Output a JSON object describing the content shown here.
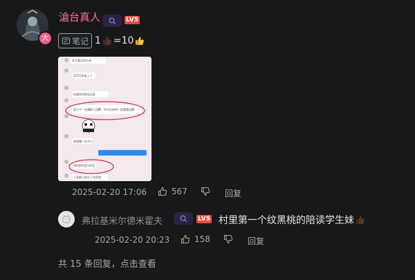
{
  "comment": {
    "username": "滄台真人",
    "avatar_badge": "大",
    "level_badge": "LV5",
    "search_icon": "search-icon",
    "note_tag_label": "笔记",
    "text_before": "1",
    "text_middle": "=10",
    "timestamp": "2025-02-20 17:06",
    "like_count": "567",
    "reply_label": "回复",
    "note_preview": {
      "lines": [
        "昨天看见你头来",
        "ZZZQ你球上了",
        "你看到的那些回复",
        "放大不一在講那人回覆，你对台紹将一起看看回覆",
        "那都爆人长不少",
        "你的那些是100位",
        "人家都已经在下年前就"
      ]
    }
  },
  "reply": {
    "username": "弗拉基米尔德米霍夫",
    "level_badge": "LV5",
    "text": "村里第一个纹黑桃的陪读学生妹",
    "timestamp": "2025-02-20 20:23",
    "like_count": "158",
    "reply_label": "回复"
  },
  "more_replies": "共 15 条回复，点击查看",
  "colors": {
    "background": "#17181a",
    "username": "#fb6e9c",
    "reply_username": "#8e8e93",
    "level_badge": "#ef4b3b",
    "meta_text": "#a8a8a8"
  }
}
